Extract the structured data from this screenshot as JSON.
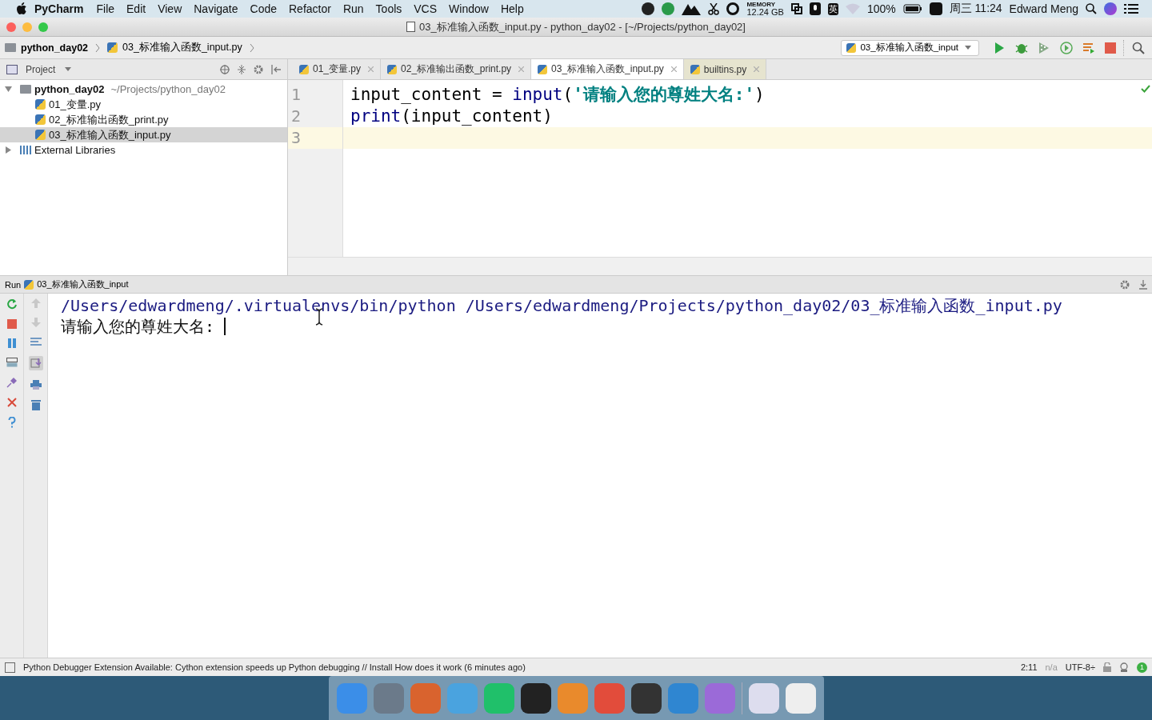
{
  "menu_bar": {
    "app": "PyCharm",
    "items": [
      "File",
      "Edit",
      "View",
      "Navigate",
      "Code",
      "Refactor",
      "Run",
      "Tools",
      "VCS",
      "Window",
      "Help"
    ],
    "memory_label": "MEMORY",
    "memory_value": "12.24 GB",
    "ime": "英",
    "battery": "100%",
    "clock": "周三 11:24",
    "user": "Edward Meng"
  },
  "window": {
    "title": "03_标准输入函数_input.py - python_day02 - [~/Projects/python_day02]"
  },
  "breadcrumb": [
    "python_day02",
    "03_标准输入函数_input.py"
  ],
  "run_config": "03_标准输入函数_input",
  "project_panel": {
    "title": "Project",
    "tree": [
      {
        "name": "python_day02",
        "path": "~/Projects/python_day02",
        "kind": "folder",
        "expanded": true,
        "selected": false,
        "children": [
          {
            "name": "01_变量.py",
            "kind": "file",
            "selected": false
          },
          {
            "name": "02_标准输出函数_print.py",
            "kind": "file",
            "selected": false
          },
          {
            "name": "03_标准输入函数_input.py",
            "kind": "file",
            "selected": true
          }
        ]
      },
      {
        "name": "External Libraries",
        "kind": "library",
        "expanded": false,
        "selected": false
      }
    ]
  },
  "tabs": [
    {
      "label": "01_变量.py",
      "selected": false
    },
    {
      "label": "02_标准输出函数_print.py",
      "selected": false
    },
    {
      "label": "03_标准输入函数_input.py",
      "selected": true
    },
    {
      "label": "builtins.py",
      "selected": false
    }
  ],
  "editor": {
    "lines": [
      {
        "number": "1",
        "current": false,
        "tokens": [
          {
            "text": "input_content = ",
            "kind": "plain"
          },
          {
            "text": "input",
            "kind": "builtin"
          },
          {
            "text": "(",
            "kind": "plain"
          },
          {
            "text": "'请输入您的尊姓大名:'",
            "kind": "string"
          },
          {
            "text": ")",
            "kind": "plain"
          }
        ]
      },
      {
        "number": "2",
        "current": false,
        "tokens": [
          {
            "text": "print",
            "kind": "builtin"
          },
          {
            "text": "(input_content)",
            "kind": "plain"
          }
        ]
      },
      {
        "number": "3",
        "current": true
      }
    ]
  },
  "run_panel": {
    "label": "Run",
    "config": "03_标准输入函数_input",
    "output": [
      {
        "text": "/Users/edwardmeng/.virtualenvs/bin/python /Users/edwardmeng/Projects/python_day02/03_标准输入函数_input.py",
        "kind": "command"
      },
      {
        "text": "请输入您的尊姓大名:",
        "kind": "prompt"
      }
    ]
  },
  "status_bar": {
    "message": "Python Debugger Extension Available: Cython extension speeds up Python debugging // Install How does it work (6 minutes ago)",
    "position": "2:11",
    "na": "n/a",
    "encoding": "UTF-8÷",
    "notifications": "1"
  }
}
